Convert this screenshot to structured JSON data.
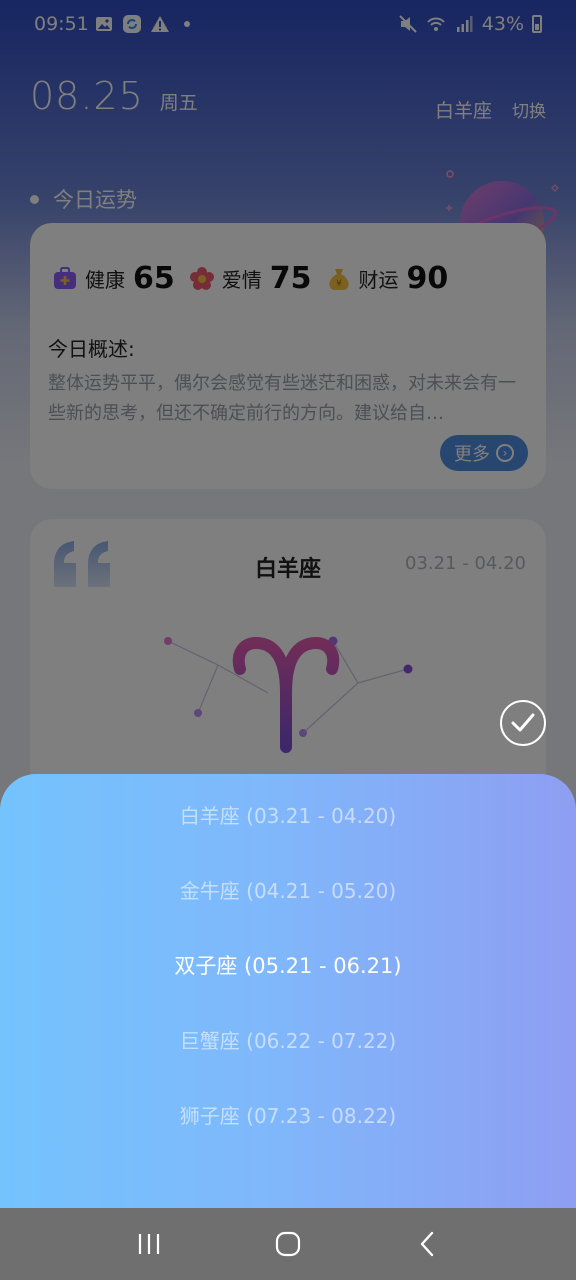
{
  "status_bar": {
    "time": "09:51",
    "battery": "43%",
    "icons": [
      "gallery-icon",
      "sync-app-icon",
      "warning-icon",
      "dot-icon",
      "mute-icon",
      "wifi-icon",
      "signal-icon",
      "battery-icon"
    ]
  },
  "header": {
    "date": "08.25",
    "weekday": "周五",
    "current_sign": "白羊座",
    "switch_label": "切换"
  },
  "today": {
    "section_title": "今日运势",
    "scores": [
      {
        "label": "健康",
        "value": "65",
        "icon": "health-kit-icon"
      },
      {
        "label": "爱情",
        "value": "75",
        "icon": "flower-icon"
      },
      {
        "label": "财运",
        "value": "90",
        "icon": "money-bag-icon"
      }
    ],
    "summary_title": "今日概述:",
    "summary_text": "整体运势平平，偶尔会感觉有些迷茫和困惑，对未来会有一些新的思考，但还不确定前行的方向。建议给自…",
    "more_label": "更多"
  },
  "sign_card": {
    "name": "白羊座",
    "date_range": "03.21 - 04.20"
  },
  "picker": {
    "selected_index": 2,
    "options": [
      "白羊座  (03.21 - 04.20)",
      "金牛座  (04.21 - 05.20)",
      "双子座  (05.21 - 06.21)",
      "巨蟹座  (06.22 - 07.22)",
      "狮子座  (07.23 - 08.22)"
    ]
  },
  "nav": {
    "buttons": [
      "recent-apps-icon",
      "home-icon",
      "back-icon"
    ]
  },
  "colors": {
    "header_blue": "#2f4bc3",
    "picker_left": "#74c3fd",
    "picker_right": "#8e9ef2",
    "more_button": "#4f8de0"
  }
}
